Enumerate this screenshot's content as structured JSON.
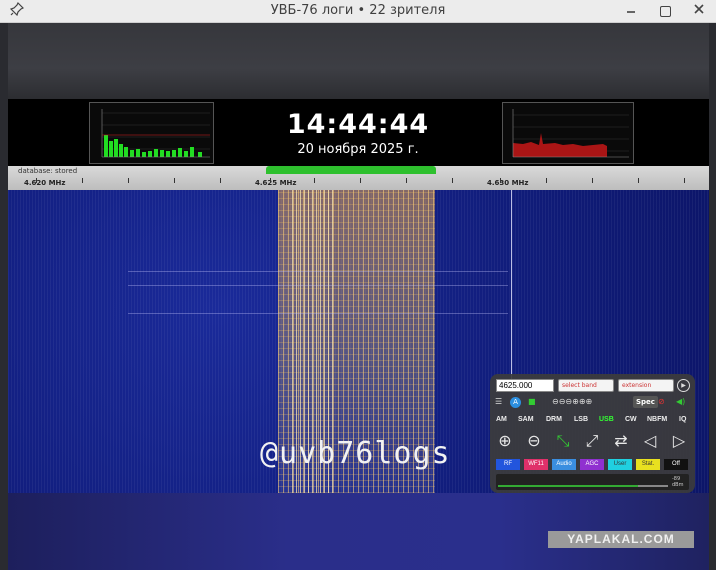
{
  "window": {
    "title": "УВБ-76 логи • 22 зрителя"
  },
  "stream": {
    "clock": "14:44:44",
    "date": "20 ноября 2025 г.",
    "watermark": "@uvb76logs"
  },
  "scale": {
    "database_label": "database: stored",
    "freq_labels": [
      "4.620 MHz",
      "4.625 MHz",
      "4.630 MHz"
    ]
  },
  "panel": {
    "frequency_value": "4625.000",
    "band_select": "select band",
    "ext_select": "extension",
    "spec_label": "Spec",
    "modes": [
      "AM",
      "SAM",
      "DRM",
      "LSB",
      "USB",
      "CW",
      "NBFM",
      "IQ"
    ],
    "active_mode": "USB",
    "colored_buttons": [
      {
        "label": "RF",
        "color": "#2255dd"
      },
      {
        "label": "WF11",
        "color": "#e0306a"
      },
      {
        "label": "Audio",
        "color": "#3a8ee0"
      },
      {
        "label": "AGC",
        "color": "#9030d0"
      },
      {
        "label": "User",
        "color": "#20d0e0"
      },
      {
        "label": "Stat.",
        "color": "#e8e020"
      },
      {
        "label": "Off",
        "color": "#111111"
      }
    ],
    "dbm_value": "-89",
    "dbm_unit": "dBm"
  },
  "site_watermark": "YAPLAKAL.COM",
  "icons": [
    "pin-icon",
    "minimize-icon",
    "maximize-icon",
    "close-icon",
    "play-icon",
    "menu-icon",
    "zoom-in-icon",
    "zoom-out-icon",
    "shrink-icon",
    "expand-icon",
    "swap-icon",
    "prev-icon",
    "next-icon",
    "speaker-icon"
  ]
}
